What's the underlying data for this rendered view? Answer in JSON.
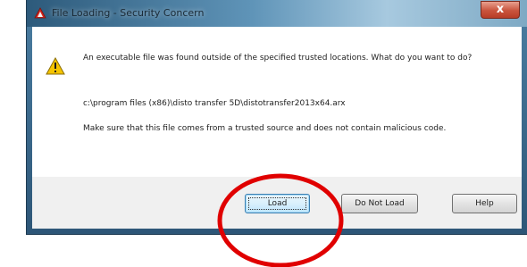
{
  "dialog": {
    "title": "File Loading - Security Concern",
    "close_glyph": "x",
    "message": "An executable file was found outside of the specified trusted locations. What do you want to do?",
    "file_path": "c:\\program files (x86)\\disto transfer 5D\\distotransfer2013x64.arx",
    "note": "Make sure that this file comes from a trusted source and does not contain malicious code.",
    "icons": {
      "title": "autocad-app-icon",
      "message": "warning-icon"
    }
  },
  "buttons": {
    "load": "Load",
    "do_not_load": "Do Not Load",
    "help": "Help"
  },
  "colors": {
    "annotation_circle": "#e00000",
    "warning_fill": "#f5c400",
    "close_button": "#c9543d"
  }
}
